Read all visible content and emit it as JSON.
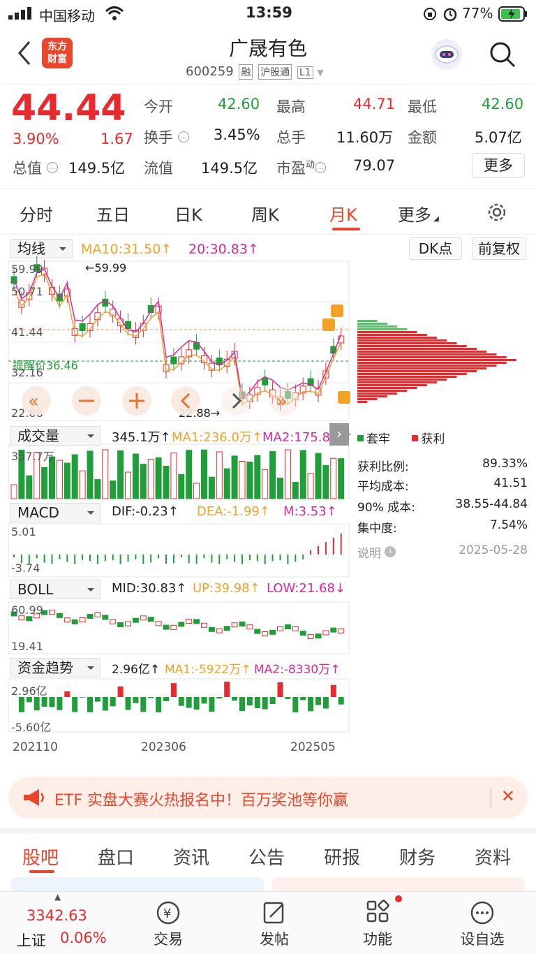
{
  "status": {
    "carrier": "中国移动",
    "time": "13:59",
    "battery": "77%"
  },
  "header": {
    "logo_line1": "东方",
    "logo_line2": "财富",
    "name": "广晟有色",
    "code": "600259",
    "tags": [
      "融",
      "沪股通",
      "L1"
    ]
  },
  "quote": {
    "price": "44.44",
    "change_pct": "3.90%",
    "change": "1.67",
    "fields": [
      {
        "label": "今开",
        "value": "42.60",
        "color": "green"
      },
      {
        "label": "最高",
        "value": "44.71",
        "color": "red"
      },
      {
        "label": "最低",
        "value": "42.60",
        "color": "green"
      },
      {
        "label": "换手",
        "value": "3.45%",
        "color": "black"
      },
      {
        "label": "总手",
        "value": "11.60万",
        "color": "black"
      },
      {
        "label": "金额",
        "value": "5.07亿",
        "color": "black"
      },
      {
        "label": "总值",
        "value": "149.5亿",
        "color": "black"
      },
      {
        "label": "流值",
        "value": "149.5亿",
        "color": "black"
      },
      {
        "label": "市盈",
        "sup": "动",
        "value": "79.07",
        "color": "black"
      }
    ],
    "more": "更多"
  },
  "ktabs": [
    "分时",
    "五日",
    "日K",
    "周K",
    "月K",
    "更多"
  ],
  "ktabs_active": "月K",
  "ma": {
    "selector": "均线",
    "ma10": "MA10:31.50↑",
    "ma20": "20:30.83↑",
    "dk": "DK点",
    "adjust": "前复权"
  },
  "kline": {
    "high_label": "59.99",
    "marker_high": "←59.99",
    "marker_low": "22.88→",
    "y_labels": [
      "59.99",
      "50.71",
      "41.44",
      "32.16",
      "22.88"
    ],
    "alert_label": "提醒价",
    "alert_value": "36.46"
  },
  "volume": {
    "selector": "成交量",
    "value": "345.1万↑",
    "ma1": "MA1:236.0万↑",
    "ma2": "MA2:175.8万↑",
    "y_top": "357.7万"
  },
  "macd": {
    "selector": "MACD",
    "dif": "DIF:-0.23↑",
    "dea": "DEA:-1.99↑",
    "m": "M:3.53↑",
    "y_top": "5.01",
    "y_bot": "-3.74"
  },
  "boll": {
    "selector": "BOLL",
    "mid": "MID:30.83↑",
    "up": "UP:39.98↑",
    "low": "LOW:21.68↓",
    "y_top": "60.99",
    "y_bot": "19.41"
  },
  "fund": {
    "selector": "资金趋势",
    "value": "2.96亿↑",
    "ma1": "MA1:-5922万↑",
    "ma2": "MA2:-8330万↑",
    "y_top": "2.96亿",
    "y_bot": "-5.60亿"
  },
  "x_labels": [
    "202110",
    "202306",
    "202505"
  ],
  "chips": {
    "legend_trapped": "套牢",
    "legend_profit": "获利",
    "rows": [
      {
        "label": "获利比例:",
        "value": "89.33%"
      },
      {
        "label": "平均成本:",
        "value": "41.51"
      },
      {
        "label": "90% 成本:",
        "value": "38.55-44.84"
      },
      {
        "label": "集中度:",
        "value": "7.54%"
      },
      {
        "label": "说明",
        "value": "2025-05-28"
      }
    ]
  },
  "banner": {
    "text": "ETF 实盘大赛火热报名中！百万奖池等你赢"
  },
  "btabs": [
    "股吧",
    "盘口",
    "资讯",
    "公告",
    "研报",
    "财务",
    "资料"
  ],
  "toolbar": {
    "index_value": "3342.63",
    "index_name": "上证",
    "index_pct": "0.06%",
    "items": [
      "交易",
      "发帖",
      "功能",
      "设自选"
    ]
  },
  "colors": {
    "up": "#e8292d",
    "down": "#1f9e3a",
    "accent": "#e8462d",
    "ma10": "#f2a229",
    "ma20": "#d6289e"
  }
}
